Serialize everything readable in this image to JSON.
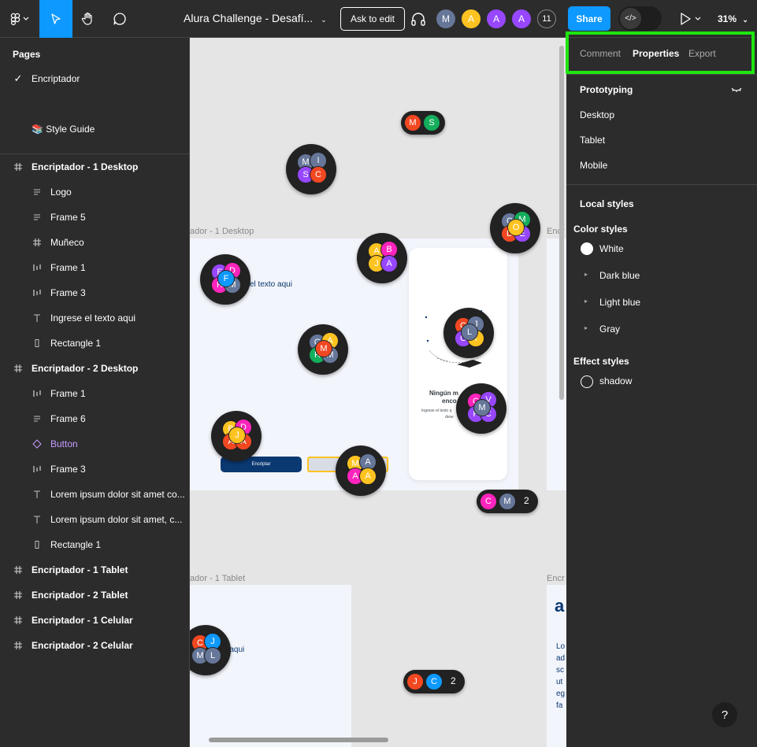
{
  "toolbar": {
    "file_title": "Alura Challenge - Desafí...",
    "ask_to_edit": "Ask to edit",
    "avatars": [
      {
        "letter": "M",
        "color": "#667799"
      },
      {
        "letter": "A",
        "color": "#ffc321"
      },
      {
        "letter": "A",
        "color": "#9747ff"
      },
      {
        "letter": "A",
        "color": "#9747ff"
      }
    ],
    "avatar_count": "11",
    "share_label": "Share",
    "dev_mode_glyph": "</>",
    "zoom": "31%"
  },
  "left_panel": {
    "pages_heading": "Pages",
    "pages": [
      {
        "label": "Encriptador",
        "selected": true
      },
      {
        "label": "📚 Style Guide",
        "selected": false
      }
    ],
    "layers": [
      {
        "label": "Encriptador - 1 Desktop",
        "icon": "frame-icon",
        "depth": 0
      },
      {
        "label": "Logo",
        "icon": "text-lines-icon",
        "depth": 1
      },
      {
        "label": "Frame 5",
        "icon": "text-lines-icon",
        "depth": 1
      },
      {
        "label": "Muñeco",
        "icon": "frame-icon",
        "depth": 1
      },
      {
        "label": "Frame 1",
        "icon": "columns-icon",
        "depth": 1
      },
      {
        "label": "Frame 3",
        "icon": "columns-icon",
        "depth": 1
      },
      {
        "label": "Ingrese el texto aqui",
        "icon": "text-icon",
        "depth": 1
      },
      {
        "label": "Rectangle 1",
        "icon": "rectangle-icon",
        "depth": 1
      },
      {
        "label": "Encriptador - 2 Desktop",
        "icon": "frame-icon",
        "depth": 0
      },
      {
        "label": "Frame 1",
        "icon": "columns-icon",
        "depth": 1
      },
      {
        "label": "Frame 6",
        "icon": "text-lines-icon",
        "depth": 1
      },
      {
        "label": "Button",
        "icon": "component-icon",
        "depth": 1
      },
      {
        "label": "Frame 3",
        "icon": "columns-icon",
        "depth": 1
      },
      {
        "label": "Lorem ipsum dolor sit amet co...",
        "icon": "text-icon",
        "depth": 1
      },
      {
        "label": "Lorem ipsum dolor sit amet, c...",
        "icon": "text-icon",
        "depth": 1
      },
      {
        "label": "Rectangle 1",
        "icon": "rectangle-icon",
        "depth": 1
      },
      {
        "label": "Encriptador - 1 Tablet",
        "icon": "frame-icon",
        "depth": 0
      },
      {
        "label": "Encriptador - 2 Tablet",
        "icon": "frame-icon",
        "depth": 0
      },
      {
        "label": "Encriptador - 1 Celular",
        "icon": "frame-icon",
        "depth": 0
      },
      {
        "label": "Encriptador - 2 Celular",
        "icon": "frame-icon",
        "depth": 0
      }
    ],
    "component_color": "#c79cff"
  },
  "canvas": {
    "frame_labels": [
      "ador - 1 Desktop",
      "Encr",
      "ador - 1 Tablet",
      "Encr"
    ],
    "texts": {
      "desktop_text": "el texto aqui",
      "encrypt_button": "Encriptar",
      "no_message": "Ningún m",
      "no_message_2": "enco",
      "ingrese": "Ingrese el texto q",
      "deseo": "dese",
      "tablet_text": "o aqui",
      "tablet_letter": "a",
      "lorem_lines": [
        "Lo",
        "ad",
        "sc",
        "ut",
        "eg",
        "fa"
      ]
    },
    "clusters": [
      {
        "letters": [
          "M",
          "I",
          "S",
          "C"
        ],
        "colors": [
          "#667799",
          "#667799",
          "#9747ff",
          "#f24822"
        ]
      },
      {
        "letters": [
          "C",
          "M",
          "D",
          "E",
          "O"
        ],
        "colors": [
          "#667799",
          "#14ae5c",
          "#f24822",
          "#9747ff",
          "#ffc321"
        ]
      },
      {
        "letters": [
          "A",
          "B",
          "J",
          "A"
        ],
        "colors": [
          "#ffc321",
          "#ff24bd",
          "#ffc321",
          "#9747ff"
        ]
      },
      {
        "letters": [
          "E",
          "D",
          "R",
          "M",
          "F"
        ],
        "colors": [
          "#9747ff",
          "#ff24bd",
          "#ff24bd",
          "#667799",
          "#0d99ff"
        ]
      },
      {
        "letters": [
          "G",
          "A",
          "R",
          "M",
          "M"
        ],
        "colors": [
          "#667799",
          "#ffc321",
          "#14ae5c",
          "#667799",
          "#f24822"
        ]
      },
      {
        "letters": [
          "C",
          "J",
          "C",
          "I",
          "L"
        ],
        "colors": [
          "#f24822",
          "#667799",
          "#9747ff",
          "#ffc321",
          "#667799"
        ]
      },
      {
        "letters": [
          "C",
          "V",
          "P",
          "C",
          "M"
        ],
        "colors": [
          "#ff24bd",
          "#9747ff",
          "#9747ff",
          "#9747ff",
          "#667799"
        ]
      },
      {
        "letters": [
          "B",
          "D",
          "A",
          "A",
          "J"
        ],
        "colors": [
          "#ffc321",
          "#ff24bd",
          "#f24822",
          "#f24822",
          "#ffc321"
        ]
      },
      {
        "letters": [
          "M",
          "A",
          "A",
          "A"
        ],
        "colors": [
          "#ffc321",
          "#667799",
          "#ff24bd",
          "#ffc321"
        ]
      },
      {
        "letters": [
          "C",
          "J",
          "M",
          "L"
        ],
        "colors": [
          "#f24822",
          "#0d99ff",
          "#667799",
          "#667799"
        ]
      }
    ],
    "pills": [
      {
        "letters": [
          "M",
          "S"
        ],
        "colors": [
          "#f24822",
          "#14ae5c"
        ],
        "count": ""
      },
      {
        "letters": [
          "C",
          "M"
        ],
        "colors": [
          "#ff24bd",
          "#667799"
        ],
        "count": "2"
      },
      {
        "letters": [
          "J",
          "C"
        ],
        "colors": [
          "#f24822",
          "#0d99ff"
        ],
        "count": "2"
      }
    ]
  },
  "right_panel": {
    "tabs": [
      "Comment",
      "Properties",
      "Export"
    ],
    "active_tab": "Properties",
    "prototyping": {
      "heading": "Prototyping",
      "devices": [
        "Desktop",
        "Tablet",
        "Mobile"
      ]
    },
    "local_styles": {
      "heading": "Local styles",
      "color_styles_heading": "Color styles",
      "color_styles": [
        {
          "label": "White",
          "expandable": false
        },
        {
          "label": "Dark blue",
          "expandable": true
        },
        {
          "label": "Light blue",
          "expandable": true
        },
        {
          "label": "Gray",
          "expandable": true
        }
      ],
      "effect_styles_heading": "Effect styles",
      "effect_styles": [
        "shadow"
      ]
    },
    "highlight_color": "#1ee510"
  },
  "help": "?"
}
